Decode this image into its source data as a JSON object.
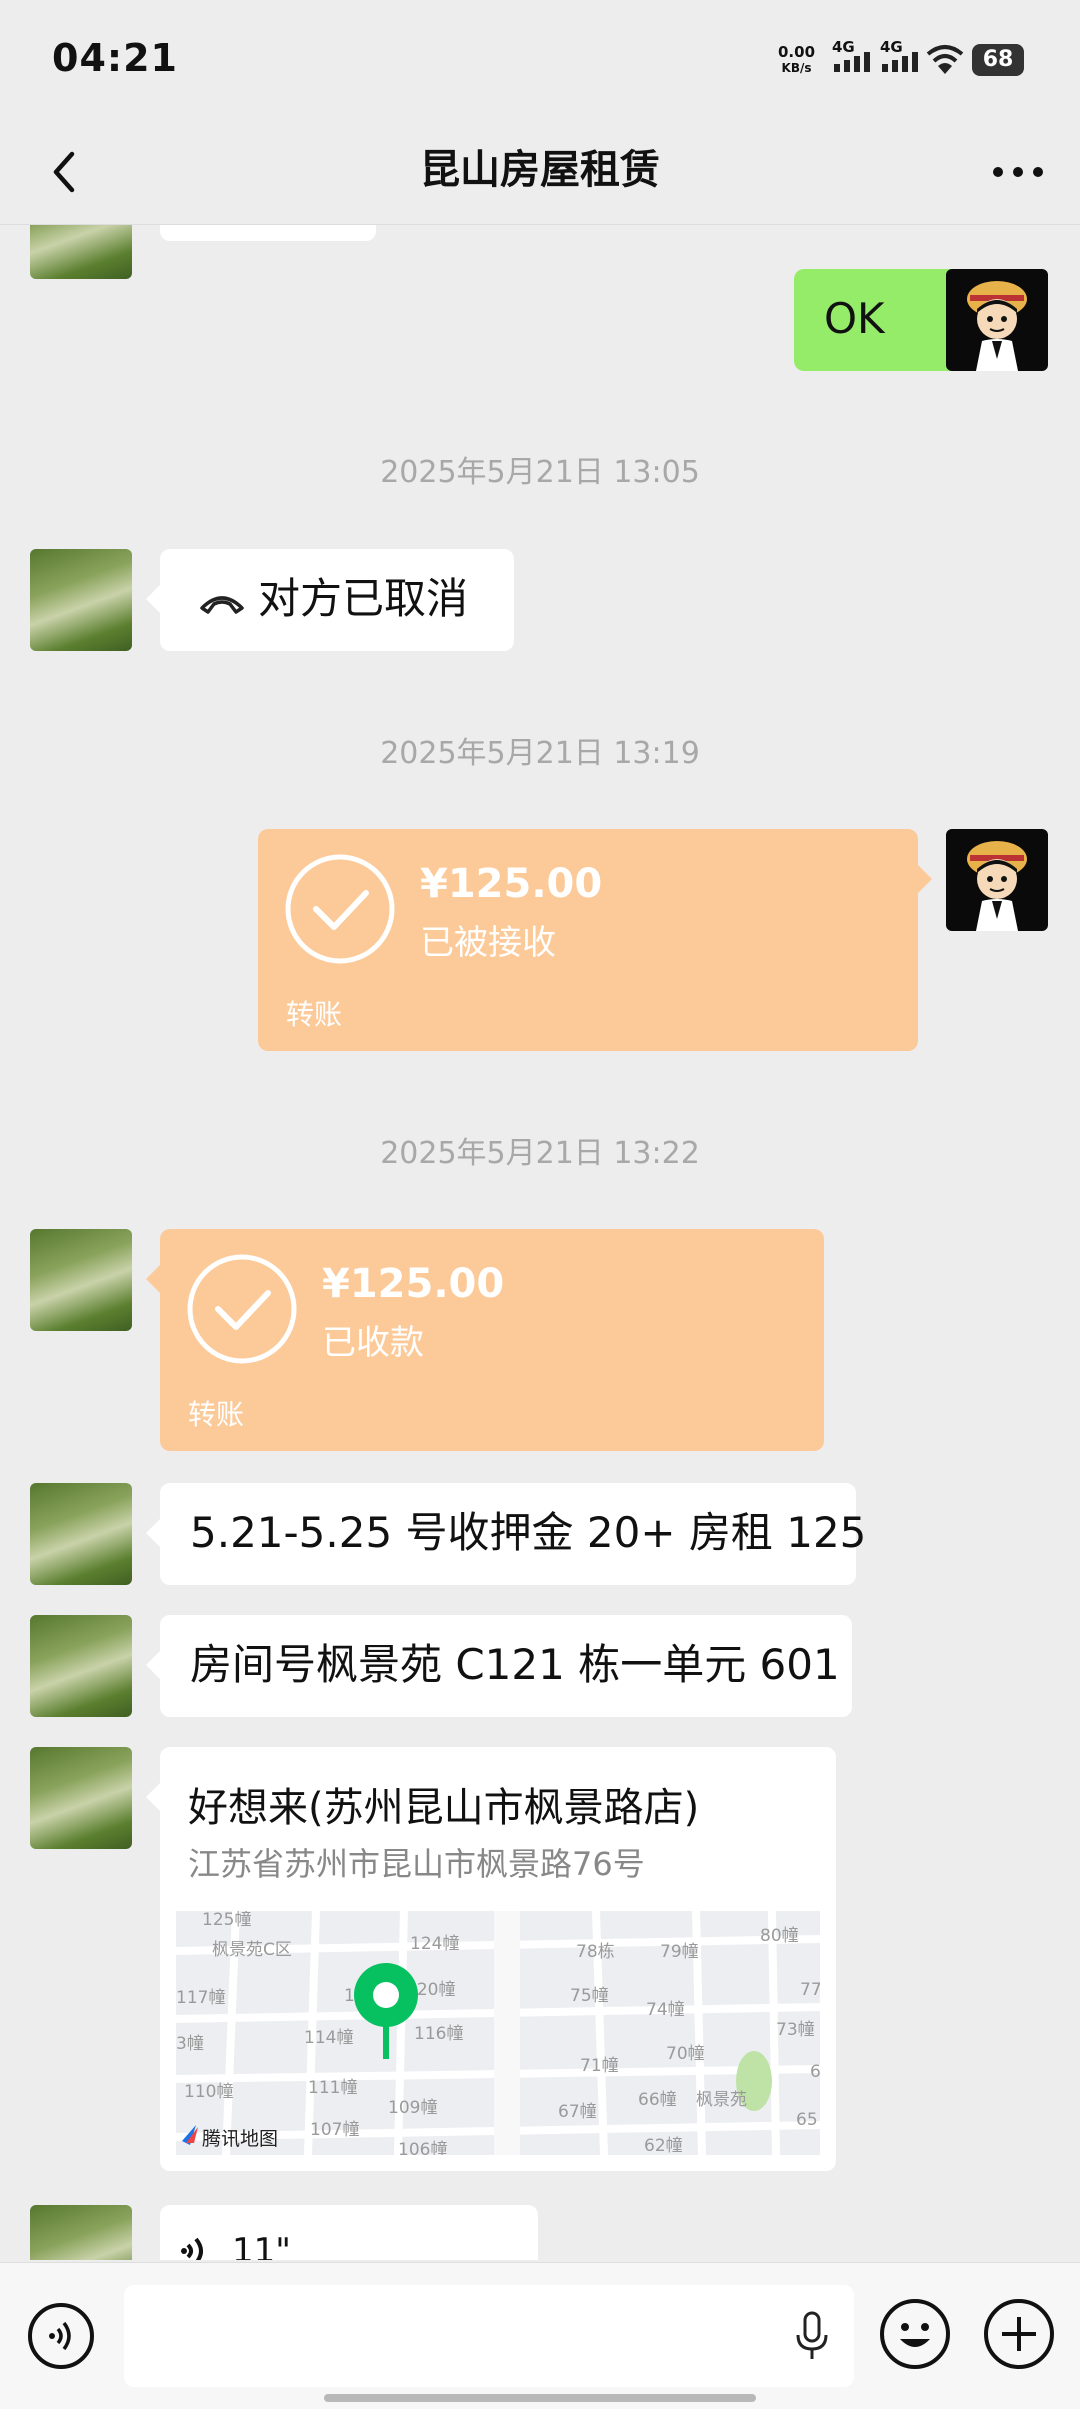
{
  "status_bar": {
    "time": "04:21",
    "net_speed": "0.00",
    "net_unit": "KB/s",
    "sig1": "4G",
    "sig2": "4G",
    "battery": "68"
  },
  "header": {
    "title": "昆山房屋租赁"
  },
  "messages": {
    "ok_text": "OK",
    "ts1": "2025年5月21日 13:05",
    "call_text": "对方已取消",
    "ts2": "2025年5月21日 13:19",
    "transfer1": {
      "amount": "¥125.00",
      "status": "已被接收",
      "label": "转账"
    },
    "ts3": "2025年5月21日 13:22",
    "transfer2": {
      "amount": "¥125.00",
      "status": "已收款",
      "label": "转账"
    },
    "text1": "5.21-5.25 号收押金 20+ 房租 125",
    "text2": "房间号枫景苑 C121 栋一单元 601",
    "location": {
      "name": "好想来(苏州昆山市枫景路店)",
      "address": "江苏省苏州市昆山市枫景路76号",
      "provider": "腾讯地图",
      "map_labels": [
        "125幢",
        "枫景苑C区",
        "124幢",
        "78栋",
        "79幢",
        "80幢",
        "117幢",
        "118幢",
        "120幢",
        "75幢",
        "74幢",
        "77",
        "114幢",
        "116幢",
        "73幢",
        "3幢",
        "70幢",
        "111幢",
        "71幢",
        "6",
        "110幢",
        "109幢",
        "66幢",
        "枫景苑",
        "107幢",
        "67幢",
        "65",
        "106幢",
        "62幢"
      ]
    },
    "voice_duration": "11\""
  },
  "colors": {
    "bg": "#ededed",
    "green_bubble": "#95ec69",
    "transfer": "#fcca99",
    "pin": "#07c160"
  }
}
